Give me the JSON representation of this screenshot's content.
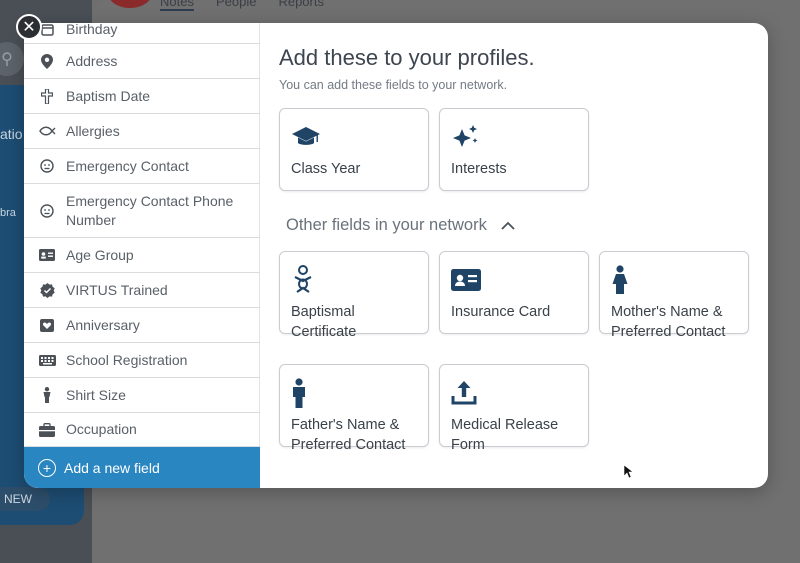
{
  "background": {
    "tabs": [
      "Notes",
      "People",
      "Reports"
    ],
    "left_fragment_1": "atio",
    "left_fragment_2": "bra",
    "new_button": "NEW"
  },
  "modal": {
    "close_icon": "close-icon",
    "sidebar": {
      "items": [
        {
          "label": "Birthday",
          "icon": "calendar-icon"
        },
        {
          "label": "Address",
          "icon": "map-pin-icon"
        },
        {
          "label": "Baptism Date",
          "icon": "cross-icon"
        },
        {
          "label": "Allergies",
          "icon": "allergy-icon"
        },
        {
          "label": "Emergency Contact",
          "icon": "face-icon"
        },
        {
          "label": "Emergency Contact Phone Number",
          "icon": "face-icon"
        },
        {
          "label": "Age Group",
          "icon": "id-card-icon"
        },
        {
          "label": "VIRTUS Trained",
          "icon": "badge-check-icon"
        },
        {
          "label": "Anniversary",
          "icon": "heart-card-icon"
        },
        {
          "label": "School Registration",
          "icon": "keyboard-icon"
        },
        {
          "label": "Shirt Size",
          "icon": "person-icon"
        },
        {
          "label": "Occupation",
          "icon": "briefcase-icon"
        }
      ],
      "add_field_label": "Add a new field"
    },
    "title": "Add these to your profiles.",
    "subtitle": "You can add these fields to your network.",
    "suggested_cards": [
      {
        "label": "Class Year",
        "icon": "graduation-cap-icon"
      },
      {
        "label": "Interests",
        "icon": "sparkles-icon"
      }
    ],
    "other_section_label": "Other fields in your network",
    "other_cards": [
      {
        "label": "Baptismal Certificate",
        "icon": "baby-icon"
      },
      {
        "label": "Insurance Card",
        "icon": "id-card-icon"
      },
      {
        "label": "Mother's Name & Preferred Contact",
        "icon": "woman-icon"
      },
      {
        "label": "Father's Name & Preferred Contact",
        "icon": "man-icon"
      },
      {
        "label": "Medical Release Form",
        "icon": "upload-icon"
      }
    ]
  },
  "colors": {
    "accent": "#2a86c1",
    "icon_dark": "#1f4466"
  }
}
